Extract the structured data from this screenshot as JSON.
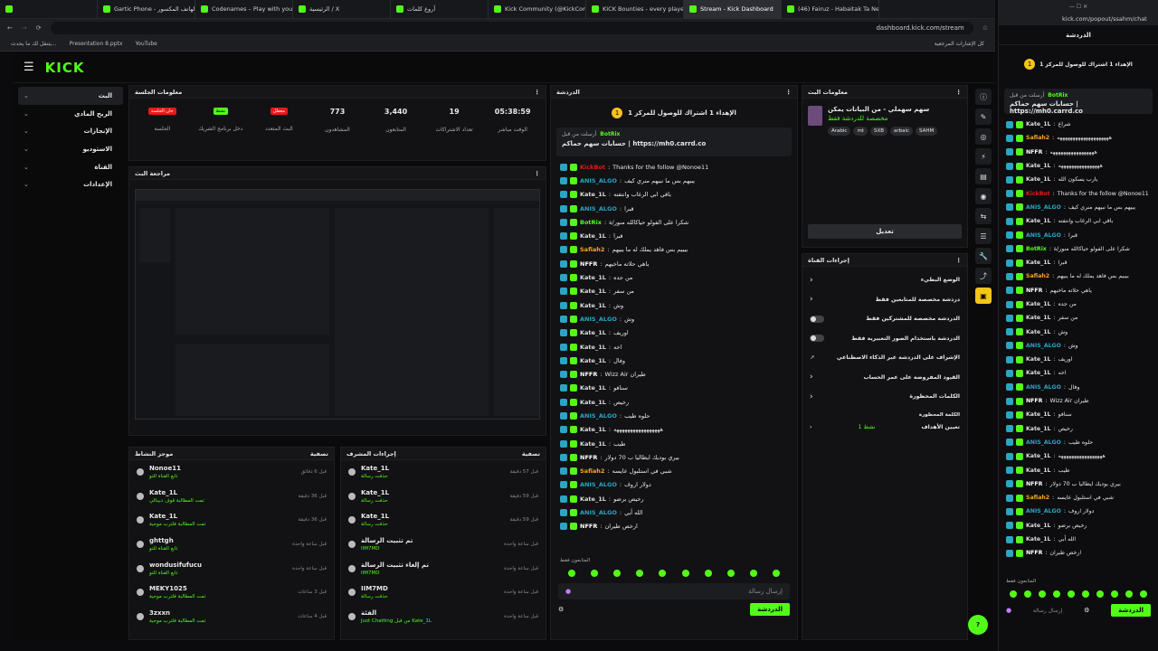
{
  "browser": {
    "tabs": [
      "",
      "Gartic Phone - الهاتف المكسور",
      "Codenames – Play with your Fri",
      "الرئيسية / X",
      "أروع كلمات",
      "Kick Community (@KickComm",
      "KICK Bounties - every player fo",
      "Stream - Kick Dashboard",
      "(46) Fairuz - Habaitak Ta Nese"
    ],
    "url": "dashboard.kick.com/stream",
    "bookmarks_left": "كل الإشارات المرجعية",
    "bookmarks_right": [
      "Presentation 8.pptx",
      "YouTube",
      "يتنقل لك ما يحدث..."
    ]
  },
  "brand": {
    "logo": "KICK",
    "accent": "#53fc18"
  },
  "nav": [
    "البث",
    "الربح المادي",
    "الإنجازات",
    "الاستوديو",
    "القناة",
    "الإعدادات"
  ],
  "session": {
    "title": "معلومات الجلسة",
    "stats": [
      {
        "value": "05:38:59",
        "label": "الوقت مباشر"
      },
      {
        "value": "19",
        "label": "تعداد الاشتراكات"
      },
      {
        "value": "3,440",
        "label": "المتابعون"
      },
      {
        "value": "773",
        "label": "المشاهدون"
      },
      {
        "value": "معطل",
        "label": "البث المتعدد",
        "badge": true,
        "color": "#e91916"
      },
      {
        "value": "نشط",
        "label": "دخل برنامج الشريك",
        "badge": true,
        "color": "#53fc18"
      },
      {
        "value": "حان الجلسة",
        "label": "الجلسة",
        "badge": true,
        "color": "#e91916"
      }
    ]
  },
  "preview": {
    "title": "مراجعة البث"
  },
  "activity": {
    "title": "موجز النشاط",
    "filter": "تصفية",
    "items": [
      {
        "name": "Nonoe11",
        "sub": "تابع القناة للتو",
        "time": "قبل 6 دقائق"
      },
      {
        "name": "Kate_1L",
        "sub": "تمت المطالبة قوف دبينالي",
        "time": "قبل 36 دقيقة"
      },
      {
        "name": "Kate_1L",
        "sub": "تمت المطالبة فلترب موحية",
        "time": "قبل 36 دقيقة"
      },
      {
        "name": "ghttgh",
        "sub": "تابع القناة للتو",
        "time": "قبل ساعة واحدة"
      },
      {
        "name": "wondusifufucu",
        "sub": "تابع القناة للتو",
        "time": "قبل ساعة واحدة"
      },
      {
        "name": "MEKY1025",
        "sub": "تمت المطالبة فلترب موحية",
        "time": "قبل 3 ساعات"
      },
      {
        "name": "3zxxn",
        "sub": "تمت المطالبة فلترب موحية",
        "time": "قبل 4 ساعات"
      }
    ]
  },
  "modactions": {
    "title": "إجراءات المشرف",
    "filter": "تصفية",
    "items": [
      {
        "name": "Kate_1L",
        "sub": "حذفت رسالة",
        "time": "قبل 57 دقيقة"
      },
      {
        "name": "Kate_1L",
        "sub": "حذفت رسالة",
        "time": "قبل 59 دقيقة"
      },
      {
        "name": "Kate_1L",
        "sub": "حذفت رسالة",
        "time": "قبل 59 دقيقة"
      },
      {
        "name": "تم تثبيت الرسالة",
        "sub": "IIM7MD",
        "time": "قبل ساعة واحدة"
      },
      {
        "name": "تم إلغاء تثبيت الرسالة",
        "sub": "IIM7MD",
        "time": "قبل ساعة واحدة"
      },
      {
        "name": "IIM7MD",
        "sub": "حذفت رسالة",
        "time": "قبل ساعة واحدة"
      },
      {
        "name": "الفئة",
        "sub": "Just Chatting من قبل Kate_1L",
        "time": "قبل ساعة واحدة"
      }
    ]
  },
  "chat": {
    "title": "الدردشة",
    "goal": "الإهداء 1 اشتراك للوصول للمركز 1",
    "pinned_user": "BotRix",
    "pinned_by": "أرسلت من قبل",
    "pinned_text": "حسابات سهم حماكم | https://mh0.carrd.co",
    "messages": [
      {
        "u": "KickBot",
        "t": "Thanks for the follow @Nonoe11",
        "c": "#e91916"
      },
      {
        "u": "ANIS_ALGO",
        "t": "يبيهم بس ما نبيهم منري كيف",
        "c": "#2aa5c5"
      },
      {
        "u": "Kate_1L",
        "t": "باقي ابي الرغاب وانتفته",
        "c": "#ddd"
      },
      {
        "u": "ANIS_ALGO",
        "t": "قبرا",
        "c": "#2aa5c5"
      },
      {
        "u": "BotRix",
        "t": "شكرا على الفولو حياكالله منور/ة",
        "c": "#53fc18"
      },
      {
        "u": "Kate_1L",
        "t": "قبرا",
        "c": "#ddd"
      },
      {
        "u": "Safiah2",
        "t": "بيبيم بس فاهد يملك له ما يبيهم",
        "c": "#f5a623"
      },
      {
        "u": "NFFR",
        "t": "ياهي حلاته ماخيهم",
        "c": "#fff"
      },
      {
        "u": "Kate_1L",
        "t": "من جده",
        "c": "#ddd"
      },
      {
        "u": "Kate_1L",
        "t": "من سفر",
        "c": "#ddd"
      },
      {
        "u": "Kate_1L",
        "t": "وش",
        "c": "#ddd"
      },
      {
        "u": "ANIS_ALGO",
        "t": "وش",
        "c": "#2aa5c5"
      },
      {
        "u": "Kate_1L",
        "t": "اوريف",
        "c": "#ddd"
      },
      {
        "u": "Kate_1L",
        "t": "اخه",
        "c": "#ddd"
      },
      {
        "u": "Kate_1L",
        "t": "وفال",
        "c": "#ddd"
      },
      {
        "u": "NFFR",
        "t": "Wizz Air طيران",
        "c": "#fff"
      },
      {
        "u": "Kate_1L",
        "t": "سنافو",
        "c": "#ddd"
      },
      {
        "u": "Kate_1L",
        "t": "رخيص",
        "c": "#ddd"
      },
      {
        "u": "ANIS_ALGO",
        "t": "حلوه طيب",
        "c": "#2aa5c5"
      },
      {
        "u": "Kate_1L",
        "t": "هههههههههههههههههه",
        "c": "#ddd"
      },
      {
        "u": "Kate_1L",
        "t": "طيب",
        "c": "#ddd"
      },
      {
        "u": "NFFR",
        "t": "بيري بوديك ايطاليا ب 70 دولار",
        "c": "#fff"
      },
      {
        "u": "Safiah2",
        "t": "شبي في استلبول عايسه",
        "c": "#f5a623"
      },
      {
        "u": "ANIS_ALGO",
        "t": "دولار اروف",
        "c": "#2aa5c5"
      },
      {
        "u": "Kate_1L",
        "t": "رخيص برضو",
        "c": "#ddd"
      },
      {
        "u": "ANIS_ALGO",
        "t": "الله أبي",
        "c": "#2aa5c5"
      },
      {
        "u": "NFFR",
        "t": "ارخص طيران",
        "c": "#fff"
      }
    ],
    "followers_only": "المتابعون فقط",
    "input_placeholder": "إرسال رسالة",
    "send_label": "الدردشة"
  },
  "stream_info": {
    "title": "معلومات البث",
    "stream_title": "سهم سهملي - من البيانات يمكن",
    "category": "مخصصة للدردشة فقط",
    "tags": [
      "Arabic",
      "mt",
      "SXB",
      "arbaic",
      "SAHM"
    ],
    "edit_label": "تعديل"
  },
  "channel_actions": {
    "title": "إجراءات القناة",
    "rows": [
      "الوضع البطيء",
      "دردشة مخصصة للمتابعين فقط",
      "الدردشة مخصصة للمشتركين فقط",
      "الدردشة باستخدام الصور التعبيرية فقط",
      "الإشراف على الدردشة عبر الذكاء الاصطناعي",
      "القيود المفروضة على عمر الحساب",
      "الكلمات المحظورة"
    ],
    "blocked_words_label": "الكلمة المحظورة",
    "goals_label": "تعيين الأهداف",
    "goals_value": "1 نشط"
  },
  "popout": {
    "url": "kick.com/popout/ssahm/chat",
    "title": "الدردشة",
    "goal": "الإهداء 1 اشتراك للوصول للمركز 1",
    "pinned_user": "BotRix",
    "pinned_by": "أرسلت من قبل",
    "pinned_text": "حسابات سهم حماكم | https://mh0.carrd.co",
    "messages": [
      {
        "u": "Kate_1L",
        "t": "شراع",
        "c": "#ddd"
      },
      {
        "u": "Safiah2",
        "t": "ههههههههههههههههههههه",
        "c": "#f5a623"
      },
      {
        "u": "NFFR",
        "t": "هههههههههههههههههه",
        "c": "#fff"
      },
      {
        "u": "Kate_1L",
        "t": "ههههههههههههههههه",
        "c": "#ddd"
      },
      {
        "u": "Kate_1L",
        "t": "يارب يسكون الله",
        "c": "#ddd"
      },
      {
        "u": "KickBot",
        "t": "Thanks for the follow @Nonoe11",
        "c": "#e91916"
      },
      {
        "u": "ANIS_ALGO",
        "t": "يبيهم بس ما نبيهم منري كيف",
        "c": "#2aa5c5"
      },
      {
        "u": "Kate_1L",
        "t": "باقي ابي الرغاب وانتفته",
        "c": "#ddd"
      },
      {
        "u": "ANIS_ALGO",
        "t": "قبرا",
        "c": "#2aa5c5"
      },
      {
        "u": "BotRix",
        "t": "شكرا على الفولو حياكالله منور/ة",
        "c": "#53fc18"
      },
      {
        "u": "Kate_1L",
        "t": "قبرا",
        "c": "#ddd"
      },
      {
        "u": "Safiah2",
        "t": "بيبيم بس فاهد يملك له ما يبيهم",
        "c": "#f5a623"
      },
      {
        "u": "NFFR",
        "t": "ياهي حلاته ماخيهم",
        "c": "#fff"
      },
      {
        "u": "Kate_1L",
        "t": "من جده",
        "c": "#ddd"
      },
      {
        "u": "Kate_1L",
        "t": "من سفر",
        "c": "#ddd"
      },
      {
        "u": "Kate_1L",
        "t": "وش",
        "c": "#ddd"
      },
      {
        "u": "ANIS_ALGO",
        "t": "وش",
        "c": "#2aa5c5"
      },
      {
        "u": "Kate_1L",
        "t": "اوريف",
        "c": "#ddd"
      },
      {
        "u": "Kate_1L",
        "t": "اخه",
        "c": "#ddd"
      },
      {
        "u": "ANIS_ALGO",
        "t": "وفال",
        "c": "#2aa5c5"
      },
      {
        "u": "NFFR",
        "t": "Wizz Air طيران",
        "c": "#fff"
      },
      {
        "u": "Kate_1L",
        "t": "سنافو",
        "c": "#ddd"
      },
      {
        "u": "Kate_1L",
        "t": "رخيص",
        "c": "#ddd"
      },
      {
        "u": "ANIS_ALGO",
        "t": "حلوه طيب",
        "c": "#2aa5c5"
      },
      {
        "u": "Kate_1L",
        "t": "هههههههههههههههههه",
        "c": "#ddd"
      },
      {
        "u": "Kate_1L",
        "t": "طيب",
        "c": "#ddd"
      },
      {
        "u": "NFFR",
        "t": "بيري بوديك ايطاليا ب 70 دولار",
        "c": "#fff"
      },
      {
        "u": "Safiah2",
        "t": "شبي في استلبول عايسه",
        "c": "#f5a623"
      },
      {
        "u": "ANIS_ALGO",
        "t": "دولار اروف",
        "c": "#2aa5c5"
      },
      {
        "u": "Kate_1L",
        "t": "رخيص برضو",
        "c": "#ddd"
      },
      {
        "u": "Kate_1L",
        "t": "الله أبي",
        "c": "#ddd"
      },
      {
        "u": "NFFR",
        "t": "ارخص طيران",
        "c": "#fff"
      }
    ],
    "followers_only": "المتابعون فقط",
    "input_placeholder": "إرسال رسالة",
    "send_label": "الدردشة"
  }
}
